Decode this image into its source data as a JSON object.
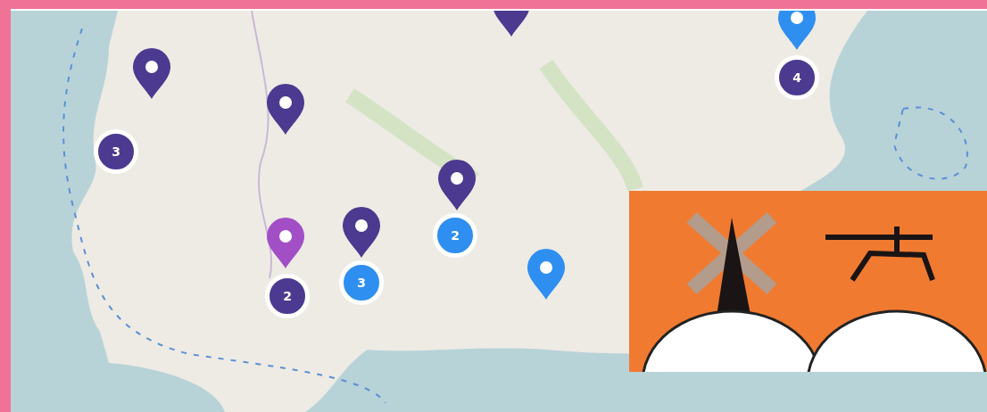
{
  "map": {
    "markers": [
      {
        "kind": "pin",
        "color": "#4b3a8f"
      },
      {
        "kind": "pin",
        "color": "#4b3a8f"
      },
      {
        "kind": "pin",
        "color": "#4b3a8f"
      },
      {
        "kind": "pin",
        "color": "#4b3a8f"
      },
      {
        "kind": "pin",
        "color": "#4b3a8f"
      },
      {
        "kind": "pin",
        "color": "#a24fc6"
      },
      {
        "kind": "pin",
        "color": "#2f8ff0"
      },
      {
        "kind": "pin",
        "color": "#2f8ff0"
      },
      {
        "kind": "cluster",
        "color": "#4b3a8f",
        "count": "3"
      },
      {
        "kind": "cluster",
        "color": "#4b3a8f",
        "count": "4"
      },
      {
        "kind": "cluster",
        "color": "#4b3a8f",
        "count": "2"
      },
      {
        "kind": "cluster",
        "color": "#2f8ff0",
        "count": "3"
      },
      {
        "kind": "cluster",
        "color": "#2f8ff0",
        "count": "2"
      }
    ]
  }
}
